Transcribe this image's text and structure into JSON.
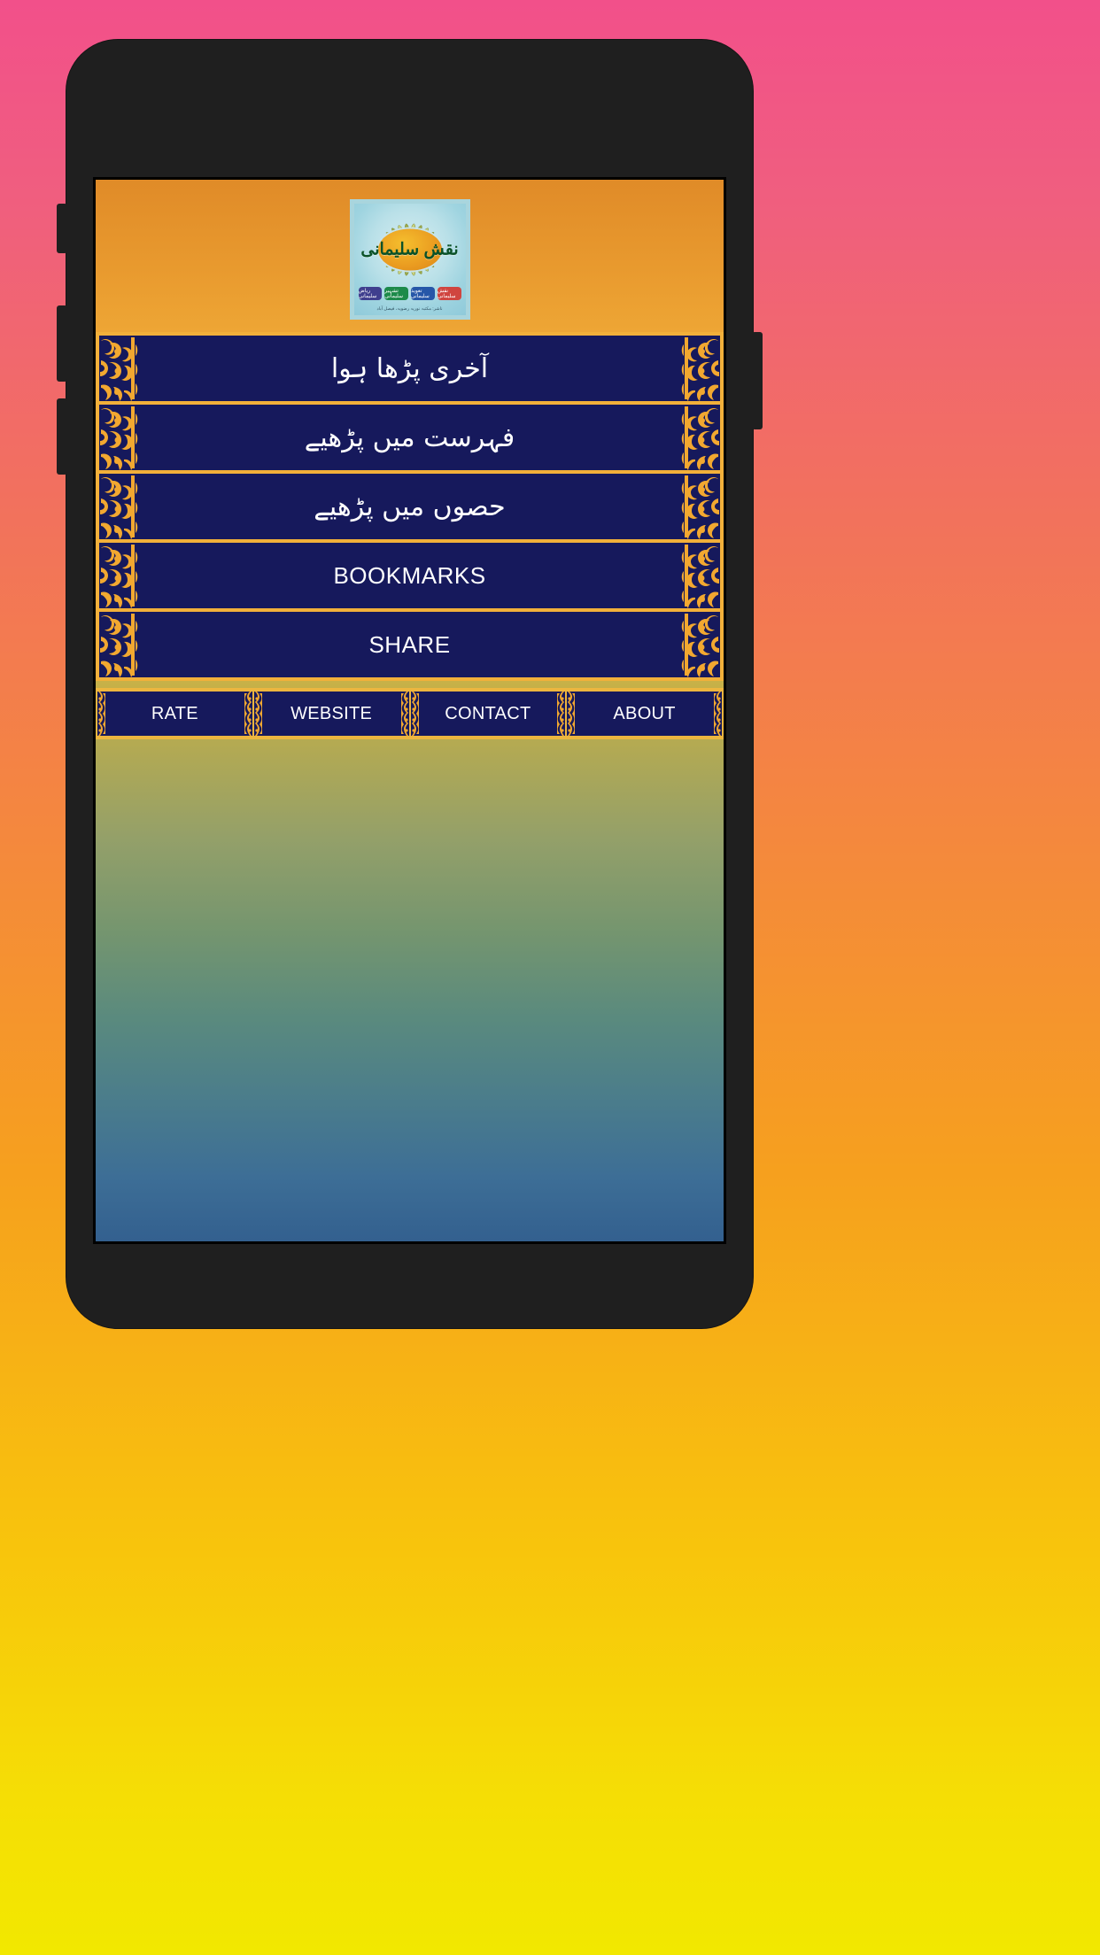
{
  "background": {
    "gradient_top_color": "#f2508a",
    "gradient_bottom_color": "#f2e800"
  },
  "device": {
    "frame_color": "#1f1f1f",
    "buttons": [
      {
        "name": "silent-switch"
      },
      {
        "name": "volume-up"
      },
      {
        "name": "volume-down"
      },
      {
        "name": "power"
      }
    ]
  },
  "app": {
    "accent_gold": "#f2b03a",
    "button_navy": "#16195c",
    "screen_gradient_top": "#e08b28",
    "screen_gradient_mid": "#d9b83f",
    "screen_gradient_bottom": "#33608f",
    "logo": {
      "border_color": "#a9d5dd",
      "center_text": "نقش سلیمانی",
      "oval_color": "#ea9b20",
      "badges": [
        {
          "label": "ریاض سلیمانی",
          "color": "#3f3f8e"
        },
        {
          "label": "تشہیر سلیمانی",
          "color": "#1d8a4a"
        },
        {
          "label": "تعویذ سلیمانی",
          "color": "#2657a8"
        },
        {
          "label": "نقش سلیمانی",
          "color": "#d0453f"
        }
      ],
      "footnote": "ناشر: مکتبہ نوریہ رضویہ، فیصل آباد"
    },
    "menu": [
      {
        "name": "last-read",
        "label": "آخری پڑھا ہوا",
        "script": "urdu"
      },
      {
        "name": "read-in-index",
        "label": "فہرست میں پڑھیے",
        "script": "urdu"
      },
      {
        "name": "read-in-sections",
        "label": "حصوں میں پڑھیے",
        "script": "urdu"
      },
      {
        "name": "bookmarks",
        "label": "BOOKMARKS",
        "script": "latin"
      },
      {
        "name": "share",
        "label": "SHARE",
        "script": "latin"
      }
    ],
    "bottom_bar": [
      {
        "name": "rate",
        "label": "RATE"
      },
      {
        "name": "website",
        "label": "WEBSITE"
      },
      {
        "name": "contact",
        "label": "CONTACT"
      },
      {
        "name": "about",
        "label": "ABOUT"
      }
    ]
  }
}
